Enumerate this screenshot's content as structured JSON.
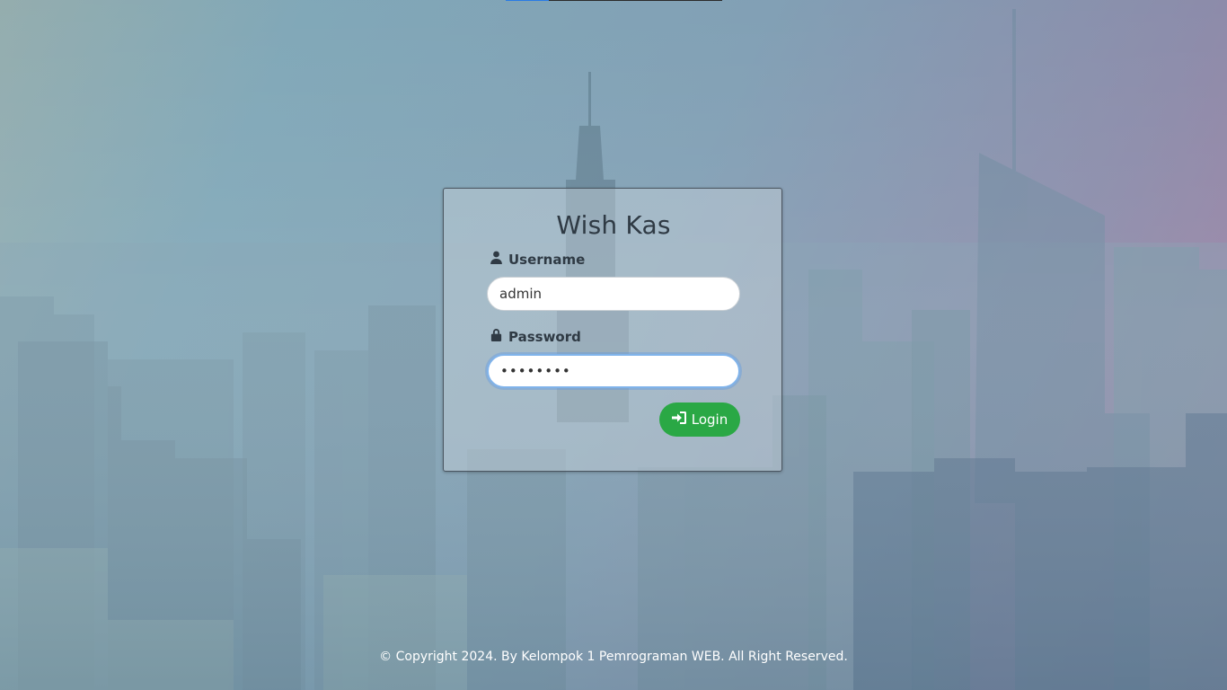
{
  "app": {
    "title": "Wish Kas"
  },
  "form": {
    "username_label": "Username",
    "username_value": "admin",
    "password_label": "Password",
    "password_value": "••••••••",
    "login_label": "Login"
  },
  "footer": {
    "text": "© Copyright 2024. By Kelompok 1 Pemrograman WEB. All Right Reserved."
  },
  "icons": {
    "username": "user-icon",
    "password": "lock-icon",
    "login": "sign-in-icon"
  },
  "colors": {
    "login_button": "#2aa845",
    "focus_ring": "#80b3ea",
    "loading_fill": "#2a7be4"
  },
  "loading_progress": 0.2
}
